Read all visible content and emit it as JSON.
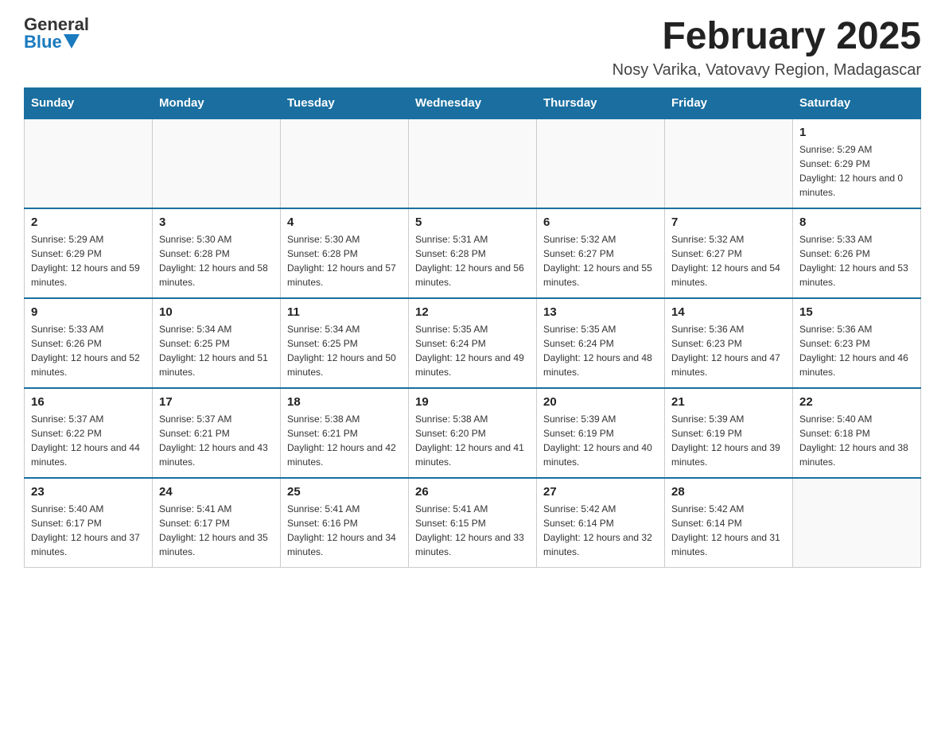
{
  "logo": {
    "text_general": "General",
    "text_blue": "Blue"
  },
  "header": {
    "month_title": "February 2025",
    "subtitle": "Nosy Varika, Vatovavy Region, Madagascar"
  },
  "days_of_week": [
    "Sunday",
    "Monday",
    "Tuesday",
    "Wednesday",
    "Thursday",
    "Friday",
    "Saturday"
  ],
  "weeks": [
    [
      {
        "day": "",
        "info": ""
      },
      {
        "day": "",
        "info": ""
      },
      {
        "day": "",
        "info": ""
      },
      {
        "day": "",
        "info": ""
      },
      {
        "day": "",
        "info": ""
      },
      {
        "day": "",
        "info": ""
      },
      {
        "day": "1",
        "info": "Sunrise: 5:29 AM\nSunset: 6:29 PM\nDaylight: 12 hours and 0 minutes."
      }
    ],
    [
      {
        "day": "2",
        "info": "Sunrise: 5:29 AM\nSunset: 6:29 PM\nDaylight: 12 hours and 59 minutes."
      },
      {
        "day": "3",
        "info": "Sunrise: 5:30 AM\nSunset: 6:28 PM\nDaylight: 12 hours and 58 minutes."
      },
      {
        "day": "4",
        "info": "Sunrise: 5:30 AM\nSunset: 6:28 PM\nDaylight: 12 hours and 57 minutes."
      },
      {
        "day": "5",
        "info": "Sunrise: 5:31 AM\nSunset: 6:28 PM\nDaylight: 12 hours and 56 minutes."
      },
      {
        "day": "6",
        "info": "Sunrise: 5:32 AM\nSunset: 6:27 PM\nDaylight: 12 hours and 55 minutes."
      },
      {
        "day": "7",
        "info": "Sunrise: 5:32 AM\nSunset: 6:27 PM\nDaylight: 12 hours and 54 minutes."
      },
      {
        "day": "8",
        "info": "Sunrise: 5:33 AM\nSunset: 6:26 PM\nDaylight: 12 hours and 53 minutes."
      }
    ],
    [
      {
        "day": "9",
        "info": "Sunrise: 5:33 AM\nSunset: 6:26 PM\nDaylight: 12 hours and 52 minutes."
      },
      {
        "day": "10",
        "info": "Sunrise: 5:34 AM\nSunset: 6:25 PM\nDaylight: 12 hours and 51 minutes."
      },
      {
        "day": "11",
        "info": "Sunrise: 5:34 AM\nSunset: 6:25 PM\nDaylight: 12 hours and 50 minutes."
      },
      {
        "day": "12",
        "info": "Sunrise: 5:35 AM\nSunset: 6:24 PM\nDaylight: 12 hours and 49 minutes."
      },
      {
        "day": "13",
        "info": "Sunrise: 5:35 AM\nSunset: 6:24 PM\nDaylight: 12 hours and 48 minutes."
      },
      {
        "day": "14",
        "info": "Sunrise: 5:36 AM\nSunset: 6:23 PM\nDaylight: 12 hours and 47 minutes."
      },
      {
        "day": "15",
        "info": "Sunrise: 5:36 AM\nSunset: 6:23 PM\nDaylight: 12 hours and 46 minutes."
      }
    ],
    [
      {
        "day": "16",
        "info": "Sunrise: 5:37 AM\nSunset: 6:22 PM\nDaylight: 12 hours and 44 minutes."
      },
      {
        "day": "17",
        "info": "Sunrise: 5:37 AM\nSunset: 6:21 PM\nDaylight: 12 hours and 43 minutes."
      },
      {
        "day": "18",
        "info": "Sunrise: 5:38 AM\nSunset: 6:21 PM\nDaylight: 12 hours and 42 minutes."
      },
      {
        "day": "19",
        "info": "Sunrise: 5:38 AM\nSunset: 6:20 PM\nDaylight: 12 hours and 41 minutes."
      },
      {
        "day": "20",
        "info": "Sunrise: 5:39 AM\nSunset: 6:19 PM\nDaylight: 12 hours and 40 minutes."
      },
      {
        "day": "21",
        "info": "Sunrise: 5:39 AM\nSunset: 6:19 PM\nDaylight: 12 hours and 39 minutes."
      },
      {
        "day": "22",
        "info": "Sunrise: 5:40 AM\nSunset: 6:18 PM\nDaylight: 12 hours and 38 minutes."
      }
    ],
    [
      {
        "day": "23",
        "info": "Sunrise: 5:40 AM\nSunset: 6:17 PM\nDaylight: 12 hours and 37 minutes."
      },
      {
        "day": "24",
        "info": "Sunrise: 5:41 AM\nSunset: 6:17 PM\nDaylight: 12 hours and 35 minutes."
      },
      {
        "day": "25",
        "info": "Sunrise: 5:41 AM\nSunset: 6:16 PM\nDaylight: 12 hours and 34 minutes."
      },
      {
        "day": "26",
        "info": "Sunrise: 5:41 AM\nSunset: 6:15 PM\nDaylight: 12 hours and 33 minutes."
      },
      {
        "day": "27",
        "info": "Sunrise: 5:42 AM\nSunset: 6:14 PM\nDaylight: 12 hours and 32 minutes."
      },
      {
        "day": "28",
        "info": "Sunrise: 5:42 AM\nSunset: 6:14 PM\nDaylight: 12 hours and 31 minutes."
      },
      {
        "day": "",
        "info": ""
      }
    ]
  ]
}
